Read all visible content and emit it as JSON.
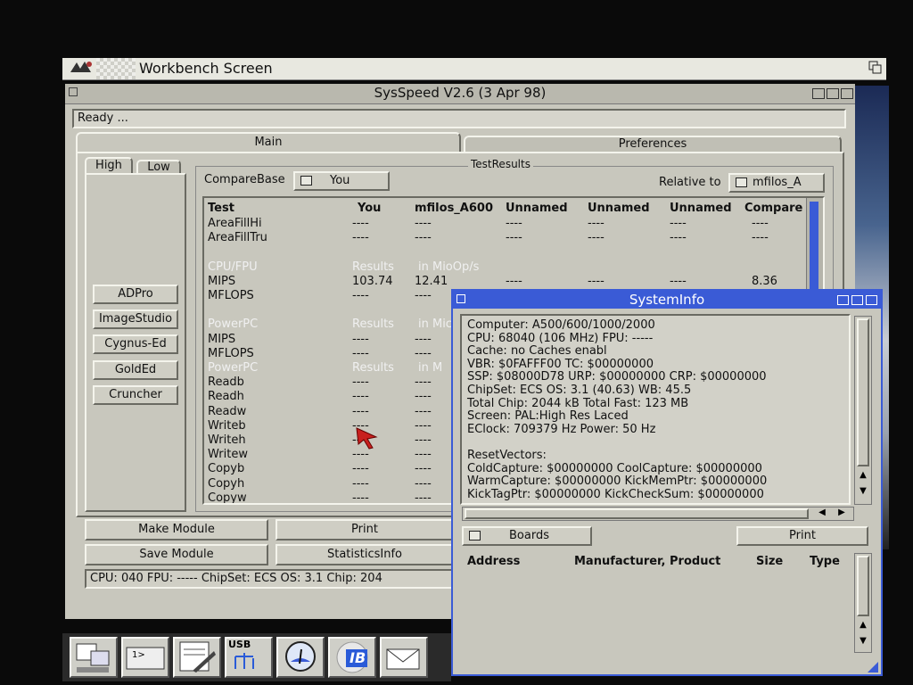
{
  "screen": {
    "title": "Workbench Screen"
  },
  "sysspeed": {
    "title": "SysSpeed  V2.6 (3 Apr 98)",
    "status": "Ready ...",
    "tabs": [
      {
        "label": "Main"
      },
      {
        "label": "Preferences"
      }
    ],
    "subtabs": [
      {
        "label": "High"
      },
      {
        "label": "Low"
      }
    ],
    "side_buttons": [
      "ADPro",
      "ImageStudio",
      "Cygnus-Ed",
      "GoldEd",
      "Cruncher"
    ],
    "group_label": "TestResults",
    "compare_base_label": "CompareBase",
    "compare_base_value": "You",
    "relative_label": "Relative to",
    "relative_value": "mfilos_A",
    "columns": [
      "Test",
      "You",
      "mfilos_A600",
      "Unnamed",
      "Unnamed",
      "Unnamed",
      "Compare"
    ],
    "rows": [
      {
        "test": "AreaFillHi",
        "you": "----",
        "c1": "----",
        "c2": "----",
        "c3": "----",
        "c4": "----",
        "cmp": "----",
        "section": false
      },
      {
        "test": "AreaFillTru",
        "you": "----",
        "c1": "----",
        "c2": "----",
        "c3": "----",
        "c4": "----",
        "cmp": "----",
        "section": false
      },
      {
        "test": "",
        "you": "",
        "c1": "",
        "c2": "",
        "c3": "",
        "c4": "",
        "cmp": "",
        "section": false
      },
      {
        "test": "CPU/FPU",
        "you": "Results",
        "c1": "in MioOp/s",
        "c2": "",
        "c3": "",
        "c4": "",
        "cmp": "",
        "section": true
      },
      {
        "test": "MIPS",
        "you": "103.74",
        "c1": "12.41",
        "c2": "----",
        "c3": "----",
        "c4": "----",
        "cmp": "8.36",
        "section": false
      },
      {
        "test": "MFLOPS",
        "you": "----",
        "c1": "----",
        "c2": "----",
        "c3": "----",
        "c4": "----",
        "cmp": "----",
        "section": false
      },
      {
        "test": "",
        "you": "",
        "c1": "",
        "c2": "",
        "c3": "",
        "c4": "",
        "cmp": "",
        "section": false
      },
      {
        "test": "PowerPC",
        "you": "Results",
        "c1": "in Mic",
        "c2": "",
        "c3": "",
        "c4": "",
        "cmp": "",
        "section": true
      },
      {
        "test": "MIPS",
        "you": "----",
        "c1": "----",
        "c2": "",
        "c3": "",
        "c4": "",
        "cmp": "",
        "section": false
      },
      {
        "test": "MFLOPS",
        "you": "----",
        "c1": "----",
        "c2": "",
        "c3": "",
        "c4": "",
        "cmp": "",
        "section": false
      },
      {
        "test": "PowerPC",
        "you": "Results",
        "c1": "in M",
        "c2": "",
        "c3": "",
        "c4": "",
        "cmp": "",
        "section": true
      },
      {
        "test": "Readb",
        "you": "----",
        "c1": "----",
        "c2": "",
        "c3": "",
        "c4": "",
        "cmp": "",
        "section": false
      },
      {
        "test": "Readh",
        "you": "----",
        "c1": "----",
        "c2": "",
        "c3": "",
        "c4": "",
        "cmp": "",
        "section": false
      },
      {
        "test": "Readw",
        "you": "----",
        "c1": "----",
        "c2": "",
        "c3": "",
        "c4": "",
        "cmp": "",
        "section": false
      },
      {
        "test": "Writeb",
        "you": "----",
        "c1": "----",
        "c2": "",
        "c3": "",
        "c4": "",
        "cmp": "",
        "section": false
      },
      {
        "test": "Writeh",
        "you": "----",
        "c1": "----",
        "c2": "",
        "c3": "",
        "c4": "",
        "cmp": "",
        "section": false
      },
      {
        "test": "Writew",
        "you": "----",
        "c1": "----",
        "c2": "",
        "c3": "",
        "c4": "",
        "cmp": "",
        "section": false
      },
      {
        "test": "Copyb",
        "you": "----",
        "c1": "----",
        "c2": "",
        "c3": "",
        "c4": "",
        "cmp": "",
        "section": false
      },
      {
        "test": "Copyh",
        "you": "----",
        "c1": "----",
        "c2": "",
        "c3": "",
        "c4": "",
        "cmp": "",
        "section": false
      },
      {
        "test": "Copyw",
        "you": "----",
        "c1": "----",
        "c2": "",
        "c3": "",
        "c4": "",
        "cmp": "",
        "section": false
      }
    ],
    "buttons": {
      "make_module": "Make Module",
      "print": "Print",
      "save_module": "Save Module",
      "statistics": "StatisticsInfo"
    },
    "footer": "CPU: 040  FPU: -----  ChipSet: ECS  OS: 3.1  Chip: 204"
  },
  "sysinfo": {
    "title": "SystemInfo",
    "lines": [
      "Computer: A500/600/1000/2000",
      "CPU: 68040 (106 MHz)  FPU: -----",
      "Cache: no Caches enabl",
      "VBR: $0FAFFF00   TC: $00000000",
      "SSP: $08000D78  URP: $00000000  CRP: $00000000",
      "ChipSet: ECS   OS: 3.1 (40.63)  WB: 45.5",
      "Total Chip: 2044 kB   Total Fast: 123 MB",
      "Screen: PAL:High Res Laced",
      "EClock: 709379 Hz   Power: 50 Hz",
      "",
      "ResetVectors:",
      "ColdCapture: $00000000   CoolCapture: $00000000",
      "WarmCapture: $00000000    KickMemPtr: $00000000",
      "KickTagPtr:  $00000000  KickCheckSum: $00000000"
    ],
    "boards_label": "Boards",
    "print_label": "Print",
    "columns": [
      "Address",
      "Manufacturer, Product",
      "Size",
      "Type"
    ]
  },
  "dock": {
    "icons": [
      "workbench-icon",
      "shell-icon",
      "editor-icon",
      "usb-icon",
      "island-icon",
      "ibrowse-icon",
      "mail-icon"
    ],
    "usb_label": "USB",
    "ib_label": "IB",
    "shell_label": "1>"
  },
  "colors": {
    "window_bg": "#c8c7bd",
    "titlebar_active": "#3a5bd6",
    "section_text": "#f0f0f0",
    "desktop": "#0a0a0a"
  }
}
